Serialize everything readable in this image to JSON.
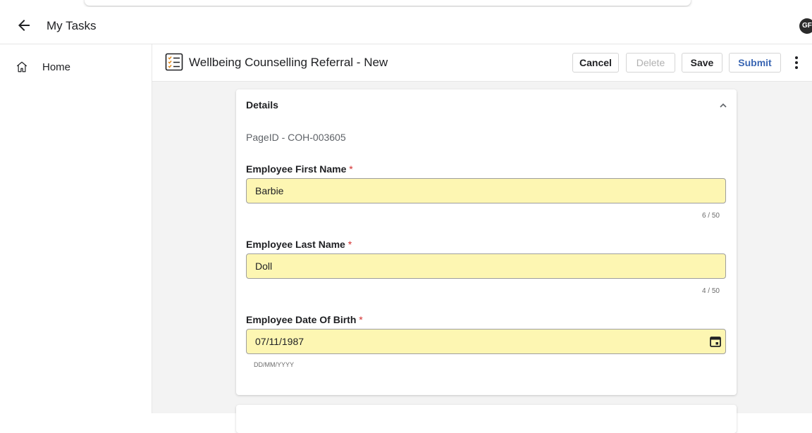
{
  "app": {
    "title": "My Tasks",
    "avatar_initials": "GF"
  },
  "sidebar": {
    "items": [
      {
        "label": "Home",
        "icon": "home-icon"
      }
    ]
  },
  "page": {
    "title": "Wellbeing Counselling Referral - New",
    "icon": "checklist-icon",
    "actions": {
      "cancel": "Cancel",
      "delete": "Delete",
      "save": "Save",
      "submit": "Submit"
    }
  },
  "form": {
    "section_title": "Details",
    "page_id": "PageID - COH-003605",
    "required_marker": "*",
    "fields": {
      "first_name": {
        "label": "Employee First Name",
        "value": "Barbie",
        "counter": "6 / 50"
      },
      "last_name": {
        "label": "Employee Last Name",
        "value": "Doll",
        "counter": "4 / 50"
      },
      "dob": {
        "label": "Employee Date Of Birth",
        "value": "07/11/1987",
        "hint": "DD/MM/YYYY"
      }
    }
  },
  "colors": {
    "field_bg": "#fdf6b2",
    "required": "#d32f2f",
    "primary": "#3a66b3",
    "main_bg": "#f3f3f3"
  }
}
